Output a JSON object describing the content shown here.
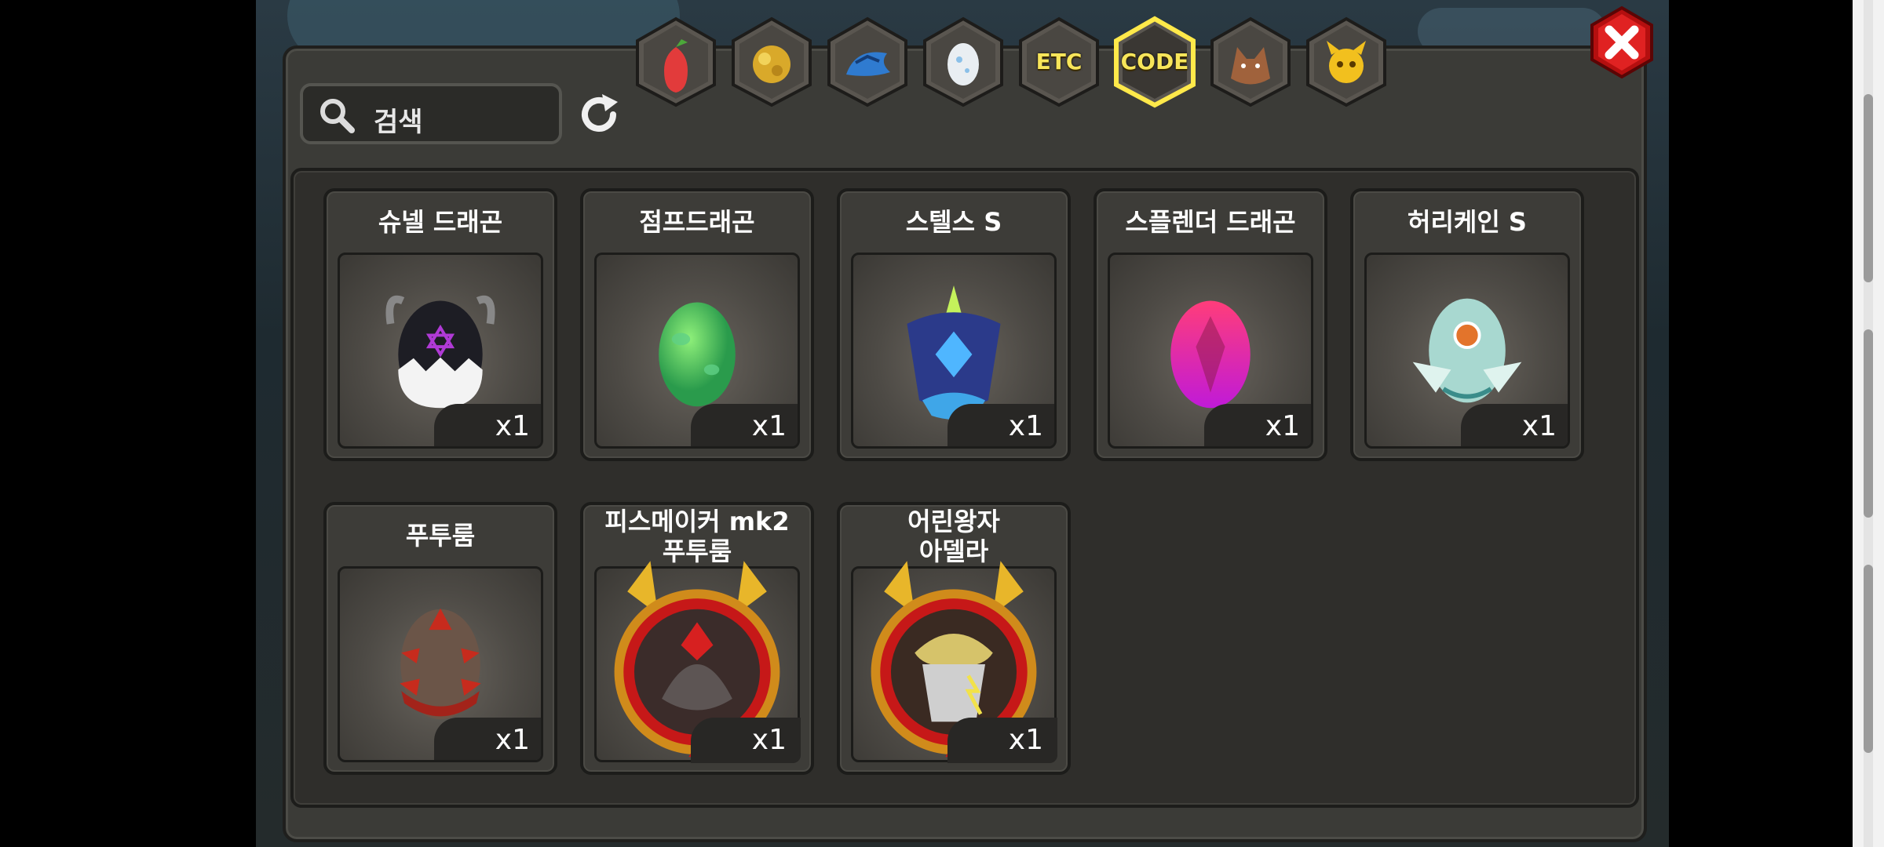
{
  "search": {
    "value": "검색"
  },
  "tabs": [
    {
      "name": "fruit",
      "label": ""
    },
    {
      "name": "gold-ore",
      "label": ""
    },
    {
      "name": "blue-dragon",
      "label": ""
    },
    {
      "name": "egg",
      "label": ""
    },
    {
      "name": "etc",
      "label": "ETC"
    },
    {
      "name": "code",
      "label": "CODE",
      "selected": true
    },
    {
      "name": "wolf",
      "label": ""
    },
    {
      "name": "pet",
      "label": ""
    }
  ],
  "items": [
    {
      "name": "슈넬 드래곤",
      "qty": "x1",
      "art": "dark-egg-icon"
    },
    {
      "name": "점프드래곤",
      "qty": "x1",
      "art": "green-egg-icon"
    },
    {
      "name": "스텔스 S",
      "qty": "x1",
      "art": "stealth-egg-icon"
    },
    {
      "name": "스플렌더 드래곤",
      "qty": "x1",
      "art": "pink-egg-icon"
    },
    {
      "name": "허리케인 S",
      "qty": "x1",
      "art": "hurricane-egg-icon"
    },
    {
      "name": "푸투룸",
      "qty": "x1",
      "art": "spiked-egg-icon"
    },
    {
      "name_line1": "피스메이커 mk2",
      "name_line2": "푸투룸",
      "qty": "x1",
      "art": "peacemaker-emblem-icon"
    },
    {
      "name_line1": "어린왕자",
      "name_line2": "아델라",
      "qty": "x1",
      "art": "prince-emblem-icon"
    }
  ]
}
